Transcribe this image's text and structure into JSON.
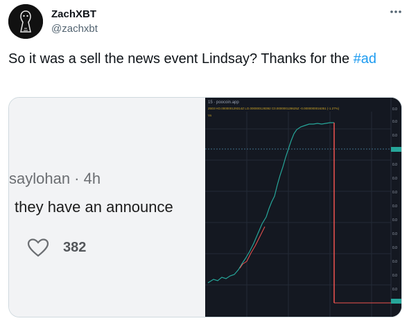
{
  "tweet": {
    "display_name": "ZachXBT",
    "handle": "@zachxbt",
    "text_main": "So it was a sell the news event Lindsay? Thanks for the ",
    "hashtag": "#ad"
  },
  "media_left": {
    "reply_meta": "saylohan · 4h",
    "reply_text": "they have an announce",
    "like_count": "382"
  },
  "media_right": {
    "chart_header_top": "15 · poocoin.app",
    "chart_header_ohlc": "2503  HO.000000129314Z  LO.000000128392  C0.000000128625Z  -0.0000000016351 (-1.27%)",
    "chart_header_vol": "Vo",
    "axis_label": "0.0"
  },
  "colors": {
    "hashtag": "#1d9bf0",
    "candles_up": "#26a69a",
    "candles_down": "#ef5350",
    "chart_bg": "#141821"
  }
}
